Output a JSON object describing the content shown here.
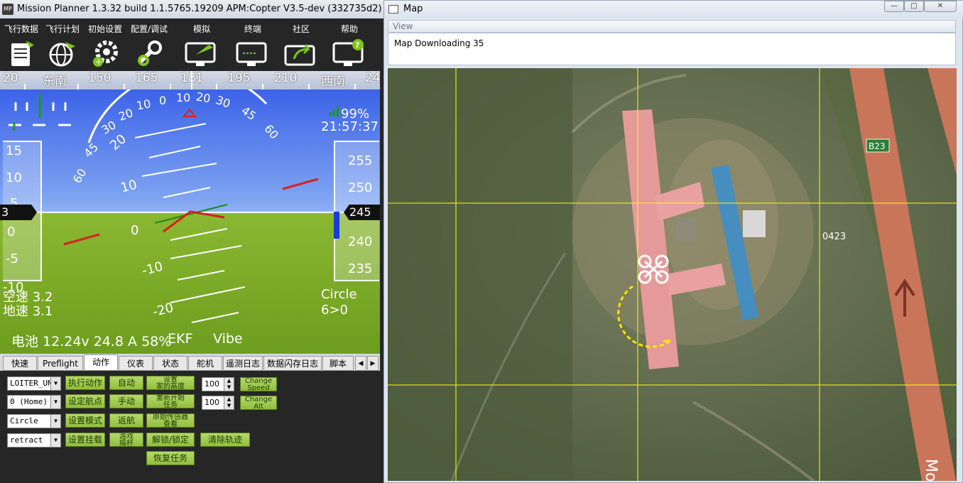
{
  "app": {
    "logo_text": "MP",
    "title": "Mission Planner 1.3.32 build 1.1.5765.19209 APM:Copter V3.5-dev (332735d2)"
  },
  "menu": [
    {
      "label": "飞行数据",
      "icon": "flight-data-icon"
    },
    {
      "label": "飞行计划",
      "icon": "flight-plan-globe-icon"
    },
    {
      "label": "初始设置",
      "icon": "initial-setup-gear-icon"
    },
    {
      "label": "配置/调试",
      "icon": "config-tuning-wrench-icon"
    },
    {
      "label": "模拟",
      "icon": "simulation-monitor-icon"
    },
    {
      "label": "终端",
      "icon": "terminal-monitor-icon"
    },
    {
      "label": "社区",
      "icon": "community-share-icon"
    },
    {
      "label": "帮助",
      "icon": "help-monitor-icon"
    }
  ],
  "compass": {
    "ticks": [
      "20",
      "东南",
      "150",
      "165",
      "181",
      "195",
      "210",
      "西南",
      "24"
    ]
  },
  "hud": {
    "pitch_labels": [
      "20",
      "10",
      "0",
      "-10",
      "-20"
    ],
    "roll_labels": [
      "60",
      "45",
      "30",
      "20",
      "10",
      "0",
      "10",
      "20",
      "30",
      "45",
      "60"
    ],
    "link_quality": "99%",
    "time": "21:57:37",
    "speed_tape": [
      "15",
      "10",
      "5",
      "0",
      "-5",
      "-10"
    ],
    "speed_box": "3",
    "alt_tape": [
      "255",
      "250",
      "240",
      "235"
    ],
    "alt_box": "245",
    "airspeed": "空速 3.2",
    "groundspeed": "地速 3.1",
    "flight_mode": "Circle",
    "wp_info": "6>0",
    "battery": "电池 12.24v 24.8 A 58%",
    "ekf": "EKF",
    "vibe": "Vibe"
  },
  "tabs": [
    "快速",
    "Preflight",
    "动作",
    "仪表",
    "状态",
    "舵机",
    "遥测日志",
    "数据闪存日志",
    "脚本"
  ],
  "active_tab": "动作",
  "actions": {
    "combo_action": "LOITER_UN",
    "combo_wp": "0 (Home)",
    "combo_mode": "Circle",
    "combo_mount": "retract",
    "btn_do_action": "执行动作",
    "btn_set_wp": "设定航点",
    "btn_set_mode": "设置模式",
    "btn_set_mount": "设置挂载",
    "btn_auto": "自动",
    "btn_manual": "手动",
    "btn_rtl": "返航",
    "btn_joystick": "游戏\n摇杆",
    "btn_set_home_alt": "设置\n家的高度",
    "btn_restart_mission": "重新开始\n任务",
    "btn_raw_sensor": "原始传感器\n查看",
    "btn_arm_disarm": "解锁/锁定",
    "btn_resume_mission": "恢复任务",
    "btn_clear_track": "清除轨迹",
    "spin_speed": "100",
    "spin_alt": "100",
    "btn_change_speed": "Change\nSpeed",
    "btn_change_alt": "Change\nAlt"
  },
  "map_window": {
    "title": "Map",
    "view_menu": "View",
    "status": "Map Downloading 35",
    "road_label": "B23",
    "field_label": "0423",
    "edge_label": "Mo"
  }
}
